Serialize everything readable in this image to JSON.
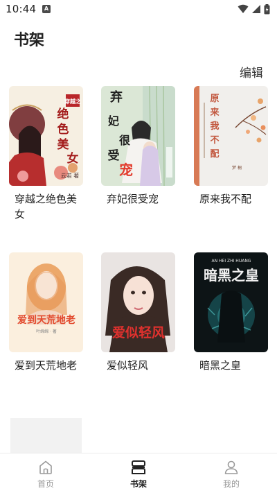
{
  "status_bar": {
    "time": "10:44",
    "notification_badge": "A"
  },
  "header": {
    "title": "书架",
    "edit_label": "编辑"
  },
  "books": [
    {
      "title": "穿越之绝色美女",
      "cover_text": "绝色美女",
      "cover_sub": "穿越之",
      "cover_author": "云若 著"
    },
    {
      "title": "弃妃很受宠",
      "cover_text": "弃妃很受宠"
    },
    {
      "title": "原来我不配",
      "cover_text": "原来我不配"
    },
    {
      "title": "爱到天荒地老",
      "cover_text": "爱到天荒地老"
    },
    {
      "title": "爱似轻风",
      "cover_text": "爱似轻风"
    },
    {
      "title": "暗黑之皇",
      "cover_text": "暗黑之皇",
      "cover_sub": "AN HEI ZHI HUANG"
    }
  ],
  "bottom_nav": {
    "home": "首页",
    "shelf": "书架",
    "mine": "我的",
    "active": "shelf"
  },
  "colors": {
    "accent": "#222222",
    "inactive": "#999999"
  }
}
